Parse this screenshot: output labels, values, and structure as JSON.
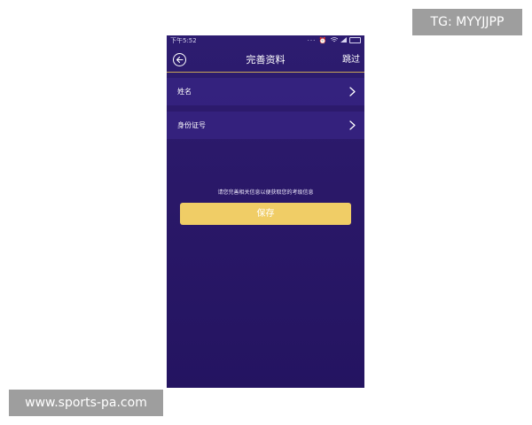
{
  "watermarks": {
    "tg": "TG: MYYJJPP",
    "site": "www.sports-pa.com"
  },
  "status_bar": {
    "time": "下午5:52",
    "icons": [
      "more-dots-icon",
      "alarm-icon",
      "wifi-icon",
      "signal-icon",
      "battery-icon"
    ]
  },
  "nav": {
    "title": "完善资料",
    "skip_label": "跳过",
    "back_icon": "back-arrow-icon"
  },
  "form": {
    "rows": [
      {
        "label": "姓名",
        "icon": "chevron-right-icon"
      },
      {
        "label": "身份证号",
        "icon": "chevron-right-icon"
      }
    ],
    "hint": "请您完善相关信息以便获取您的考级信息",
    "save_label": "保存"
  },
  "colors": {
    "background": "#2a1868",
    "accent_line": "#c9a556",
    "save_button": "#f0cd66"
  }
}
